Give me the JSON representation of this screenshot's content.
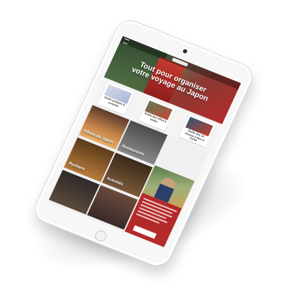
{
  "hero": {
    "title_line1": "Tout pour organiser",
    "title_line2": "votre voyage au Japon"
  },
  "cards": [
    {
      "label": "Guide pratique & conseils"
    },
    {
      "label": "Guide des villes à visiter"
    },
    {
      "label": "Guide des 10 choses à faire à Kyoto"
    }
  ],
  "tiles": [
    {
      "label": "Hôtels au Japon"
    },
    {
      "label": "Restaurants"
    },
    {
      "label": "Ryokans"
    },
    {
      "label": "Activités"
    }
  ],
  "colors": {
    "brand_red": "#b42a2a",
    "tablet_body": "#f7f7f7"
  }
}
